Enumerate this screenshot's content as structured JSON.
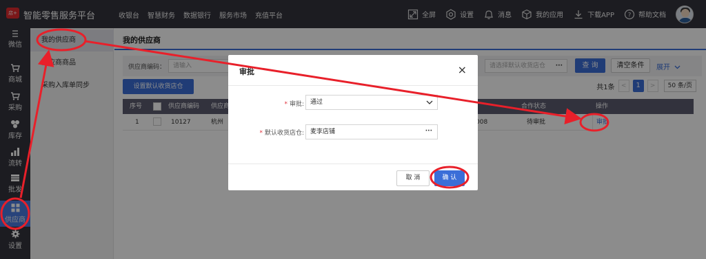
{
  "header": {
    "logo_text": "店+",
    "title": "智能零售服务平台",
    "nav": [
      "收银台",
      "智慧财务",
      "数据银行",
      "服务市场",
      "充值平台"
    ],
    "right": {
      "fullscreen": "全屏",
      "settings": "设置",
      "messages": "消息",
      "my_apps": "我的应用",
      "download_app": "下载APP",
      "help_docs": "帮助文档"
    }
  },
  "rail": {
    "items": [
      {
        "label": "微信",
        "icon": "wechat-icon"
      },
      {
        "label": "商城",
        "icon": "cart-icon"
      },
      {
        "label": "采购",
        "icon": "purchase-cart-icon"
      },
      {
        "label": "库存",
        "icon": "inventory-icon"
      },
      {
        "label": "流转",
        "icon": "transfer-icon"
      },
      {
        "label": "批发",
        "icon": "wholesale-icon"
      },
      {
        "label": "供应商",
        "icon": "grid-icon"
      },
      {
        "label": "设置",
        "icon": "gear-icon"
      }
    ]
  },
  "subside": {
    "items": [
      "我的供应商",
      "供应商商品",
      "采购入库单同步"
    ]
  },
  "main": {
    "page_title": "我的供应商",
    "filter": {
      "code_label": "供应商编码：",
      "code_placeholder": "请输入",
      "store_placeholder": "请选择默认收货店仓",
      "dots": "···",
      "query": "查 询",
      "clear": "清空条件",
      "expand": "展开"
    },
    "set_store_button": "设置默认收货店仓",
    "pager": {
      "total": "共1条",
      "current_page": "1",
      "page_size": "50 条/页"
    },
    "table": {
      "headers": {
        "index": "序号",
        "code": "供应商编码",
        "name": "供应商",
        "status": "合作状态",
        "op": "操作"
      },
      "rows": [
        {
          "index": "1",
          "code": "10127",
          "name": "杭州",
          "number": "008",
          "status": "待审批",
          "op": "审批"
        }
      ]
    }
  },
  "modal": {
    "title": "审批",
    "close": "×",
    "approve_label": "审批:",
    "approve_value": "通过",
    "store_label": "默认收货店仓:",
    "store_value": "麦李店铺",
    "dots": "···",
    "cancel": "取 消",
    "confirm": "确 认"
  },
  "colors": {
    "accent": "#3b6ed8",
    "dark_nav": "#33333d",
    "annotation": "#e8202a"
  }
}
